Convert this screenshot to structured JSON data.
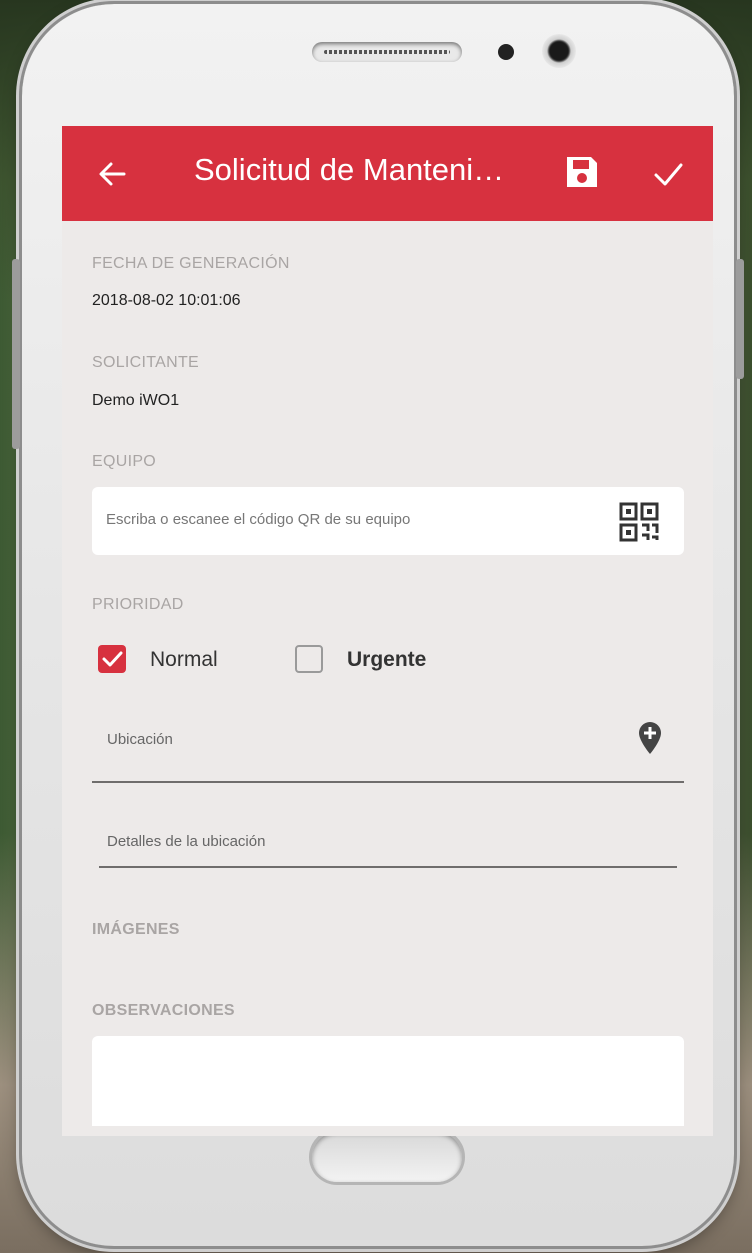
{
  "appbar": {
    "title": "Solicitud de Manteni…",
    "back_icon": "arrow-left-icon",
    "save_icon": "floppy-save-icon",
    "confirm_icon": "check-icon",
    "color": "#d7313f"
  },
  "form": {
    "fecha_label": "FECHA DE GENERACIÓN",
    "fecha_value": "2018-08-02 10:01:06",
    "solicitante_label": "SOLICITANTE",
    "solicitante_value": "Demo iWO1",
    "equipo_label": "EQUIPO",
    "equipo_placeholder": "Escriba o escanee el código QR de su equipo",
    "prioridad_label": "PRIORIDAD",
    "prioridad_options": [
      {
        "label": "Normal",
        "checked": true
      },
      {
        "label": "Urgente",
        "checked": false
      }
    ],
    "ubicacion_placeholder": "Ubicación",
    "detalles_placeholder": "Detalles de la ubicación",
    "imagenes_label": "IMÁGENES",
    "observaciones_label": "OBSERVACIONES"
  }
}
